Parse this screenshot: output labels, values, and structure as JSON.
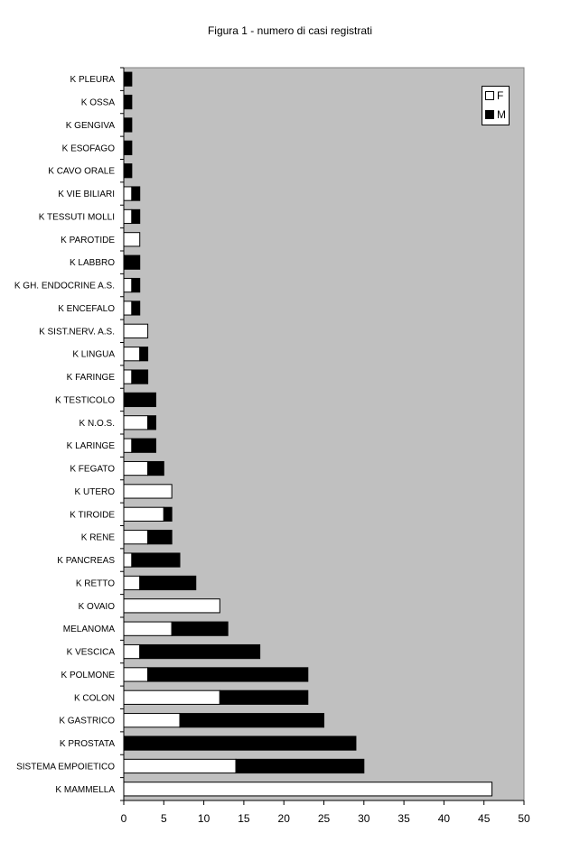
{
  "chart_data": {
    "type": "bar",
    "orientation": "horizontal",
    "stacked": true,
    "title": "Figura 1 - numero di casi registrati",
    "xlabel": "",
    "ylabel": "",
    "xlim": [
      0,
      50
    ],
    "xticks": [
      "0",
      "5",
      "10",
      "15",
      "20",
      "25",
      "30",
      "35",
      "40",
      "45",
      "50"
    ],
    "grid": false,
    "legend_position": "top-right",
    "categories": [
      "K PLEURA",
      "K OSSA",
      "K GENGIVA",
      "K ESOFAGO",
      "K CAVO ORALE",
      "K VIE BILIARI",
      "K TESSUTI MOLLI",
      "K PAROTIDE",
      "K LABBRO",
      "K GH. ENDOCRINE A.S.",
      "K ENCEFALO",
      "K SIST.NERV. A.S.",
      "K LINGUA",
      "K FARINGE",
      "K TESTICOLO",
      "K N.O.S.",
      "K LARINGE",
      "K FEGATO",
      "K UTERO",
      "K TIROIDE",
      "K RENE",
      "K PANCREAS",
      "K RETTO",
      "K OVAIO",
      "MELANOMA",
      "K VESCICA",
      "K POLMONE",
      "K COLON",
      "K GASTRICO",
      "K PROSTATA",
      "SISTEMA EMPOIETICO",
      "K MAMMELLA"
    ],
    "series": [
      {
        "name": "F",
        "color": "#ffffff",
        "values": [
          0,
          0,
          0,
          0,
          0,
          1,
          1,
          2,
          0,
          1,
          1,
          3,
          2,
          1,
          0,
          3,
          1,
          3,
          6,
          5,
          3,
          1,
          2,
          12,
          6,
          2,
          3,
          12,
          7,
          0,
          14,
          46
        ]
      },
      {
        "name": "M",
        "color": "#000000",
        "values": [
          1,
          1,
          1,
          1,
          1,
          1,
          1,
          0,
          2,
          1,
          1,
          0,
          1,
          2,
          4,
          1,
          3,
          2,
          0,
          1,
          3,
          6,
          7,
          0,
          7,
          15,
          20,
          11,
          18,
          29,
          16,
          0
        ]
      }
    ],
    "plot_background": "#c0c0c0"
  }
}
